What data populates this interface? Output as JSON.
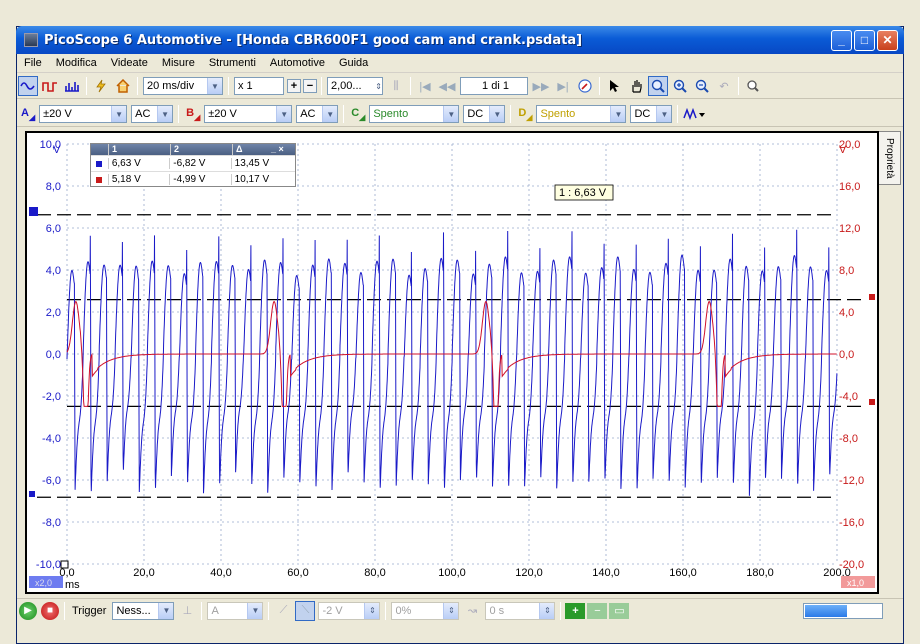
{
  "window": {
    "title": "PicoScope 6 Automotive - [Honda CBR600F1 good cam and crank.psdata]",
    "buttons": {
      "minimize": "_",
      "maximize": "□",
      "close": "✕"
    }
  },
  "menu": [
    "File",
    "Modifica",
    "Videate",
    "Misure",
    "Strumenti",
    "Automotive",
    "Guida"
  ],
  "toolbar": {
    "timebase": "20 ms/div",
    "zoom": "x 1",
    "samples": "2,00...",
    "buffer": "1 di 1"
  },
  "channels": {
    "a": {
      "label": "A",
      "range": "±20 V",
      "coupling": "AC",
      "color": "#1a1ac8"
    },
    "b": {
      "label": "B",
      "range": "±20 V",
      "coupling": "AC",
      "color": "#c81a1a"
    },
    "c": {
      "label": "C",
      "range": "Spento",
      "coupling": "DC"
    },
    "d": {
      "label": "D",
      "range": "Spento",
      "coupling": "DC"
    }
  },
  "properties_tab": "Proprietà",
  "rulers": {
    "header": [
      "1",
      "2",
      "Δ",
      "_ ×"
    ],
    "rows": [
      {
        "color": "#1a1ac8",
        "v1": "6,63 V",
        "v2": "-6,82 V",
        "delta": "13,45 V"
      },
      {
        "color": "#c81a1a",
        "v1": "5,18 V",
        "v2": "-4,99 V",
        "delta": "10,17 V"
      }
    ]
  },
  "tooltip": "1 : 6,63 V",
  "axes": {
    "left_ticks": [
      "10,0",
      "8,0",
      "6,0",
      "4,0",
      "2,0",
      "0,0",
      "-2,0",
      "-4,0",
      "-6,0",
      "-8,0",
      "-10,0"
    ],
    "left_unit": "V",
    "right_ticks": [
      "20,0",
      "16,0",
      "12,0",
      "8,0",
      "4,0",
      "0,0",
      "-4,0",
      "-8,0",
      "-12,0",
      "-16,0",
      "-20,0"
    ],
    "right_unit": "V",
    "x_ticks": [
      "0,0",
      "20,0",
      "40,0",
      "60,0",
      "80,0",
      "100,0",
      "120,0",
      "140,0",
      "160,0",
      "180,0",
      "200,0"
    ],
    "x_unit": "ms",
    "left_scale": "x2,0",
    "right_scale": "x1,0"
  },
  "chart_data": {
    "type": "line",
    "xlabel": "ms",
    "xlim": [
      0,
      200
    ],
    "series": [
      {
        "name": "A",
        "ylim": [
          -10,
          10
        ],
        "description_of_shape": "crank signal oscillating between about -6.8 and 6.6 V, period about 4.2 ms"
      },
      {
        "name": "B",
        "ylim": [
          -20,
          20
        ],
        "description_of_shape": "cam signal near 0 V with pulses near 3.5, 55, 110 and 168 ms reaching about 5 V and -5 V"
      }
    ]
  },
  "status": {
    "trigger_label": "Trigger",
    "trigger_mode": "Ness...",
    "trigger_source": "A",
    "trigger_level": "-2 V",
    "pre_trigger": "0%",
    "delay": "0 s",
    "progress": 0.55
  }
}
